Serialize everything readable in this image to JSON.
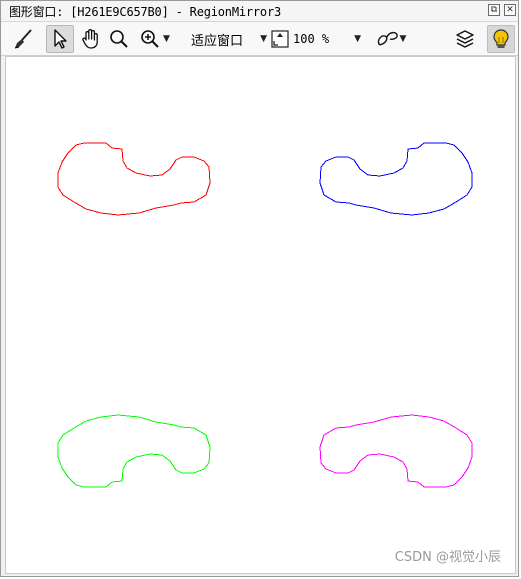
{
  "window": {
    "title": "图形窗口: [H261E9C657B0] - RegionMirror3",
    "restore_icon": "restore-icon",
    "close_icon": "close-icon"
  },
  "toolbar": {
    "tools": [
      {
        "name": "brush-icon"
      },
      {
        "name": "pointer-icon",
        "active": true
      },
      {
        "name": "hand-pan-icon"
      },
      {
        "name": "magnify-icon"
      },
      {
        "name": "zoom-in-icon"
      }
    ],
    "fit_window_label": "适应窗口",
    "zoom_value": "100 %",
    "draw_mode_icon": "draw-region-icon",
    "layers_icon": "layers-icon",
    "tip_icon": "lightbulb-icon"
  },
  "regions": [
    {
      "name": "region-original",
      "color": "#ff0000"
    },
    {
      "name": "region-mirror-horizontal",
      "color": "#0000ff"
    },
    {
      "name": "region-mirror-vertical",
      "color": "#00ff00"
    },
    {
      "name": "region-mirror-both",
      "color": "#ff00ff"
    }
  ],
  "watermark": "CSDN @视觉小辰"
}
